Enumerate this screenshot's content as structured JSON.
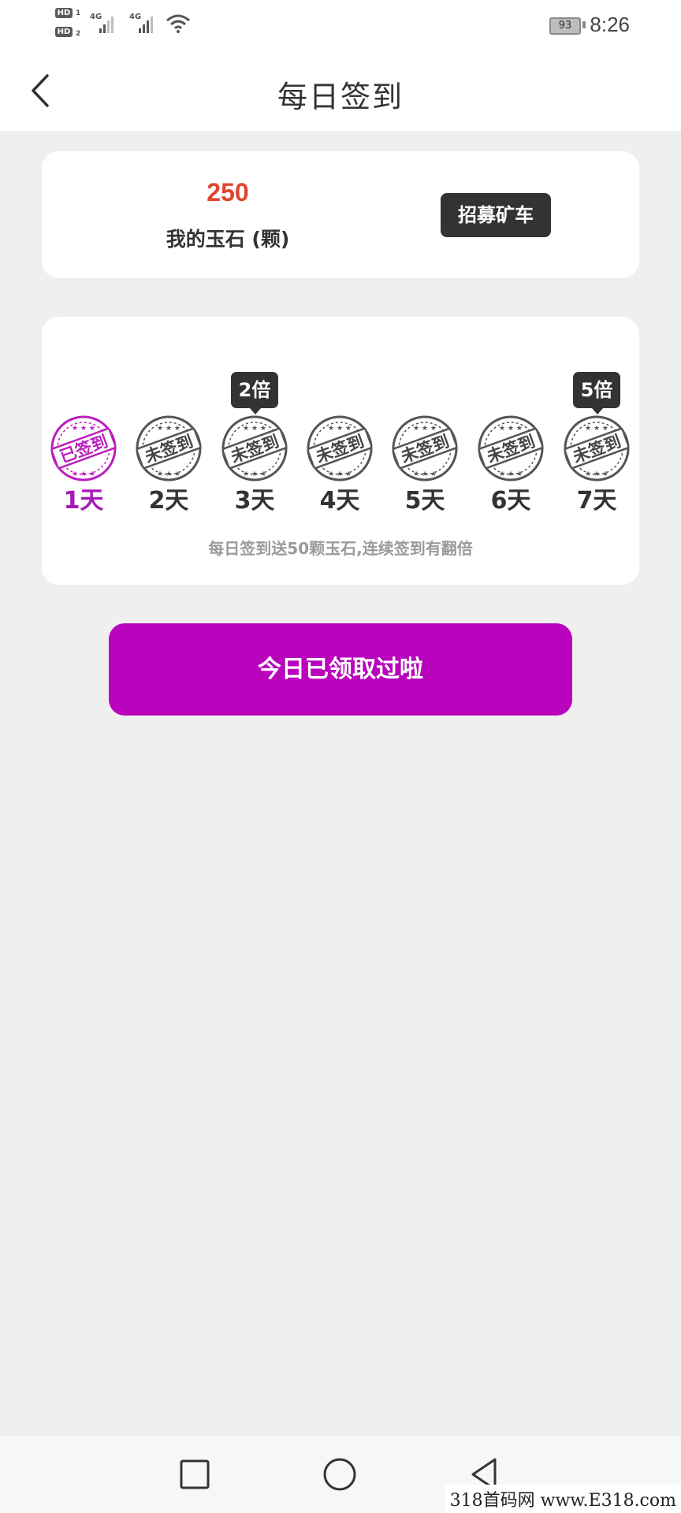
{
  "status_bar": {
    "hd1": "HD",
    "hd1_sub": "1",
    "hd2": "HD",
    "hd2_sub": "2",
    "net1": "4G",
    "net2": "4G",
    "battery": "93",
    "time": "8:26",
    "icons": [
      "signal-icon",
      "wifi-icon",
      "battery-icon"
    ]
  },
  "header": {
    "title": "每日签到",
    "back_icon": "back-arrow-icon"
  },
  "balance": {
    "value": "250",
    "label": "我的玉石 (颗)",
    "recruit_label": "招募矿车"
  },
  "signin": {
    "days": [
      {
        "label": "1天",
        "stamp": "已签到",
        "signed": true,
        "multiplier": ""
      },
      {
        "label": "2天",
        "stamp": "未签到",
        "signed": false,
        "multiplier": ""
      },
      {
        "label": "3天",
        "stamp": "未签到",
        "signed": false,
        "multiplier": "2倍"
      },
      {
        "label": "4天",
        "stamp": "未签到",
        "signed": false,
        "multiplier": ""
      },
      {
        "label": "5天",
        "stamp": "未签到",
        "signed": false,
        "multiplier": ""
      },
      {
        "label": "6天",
        "stamp": "未签到",
        "signed": false,
        "multiplier": ""
      },
      {
        "label": "7天",
        "stamp": "未签到",
        "signed": false,
        "multiplier": "5倍"
      }
    ],
    "note": "每日签到送50颗玉石,连续签到有翻倍"
  },
  "claim_button": "今日已领取过啦",
  "colors": {
    "accent": "#b903bd",
    "signed_text": "#a618b8",
    "balance_value": "#e2442e",
    "dark_badge": "#333333",
    "background": "#efeff0"
  },
  "watermark": "318首码网 www.E318.com"
}
